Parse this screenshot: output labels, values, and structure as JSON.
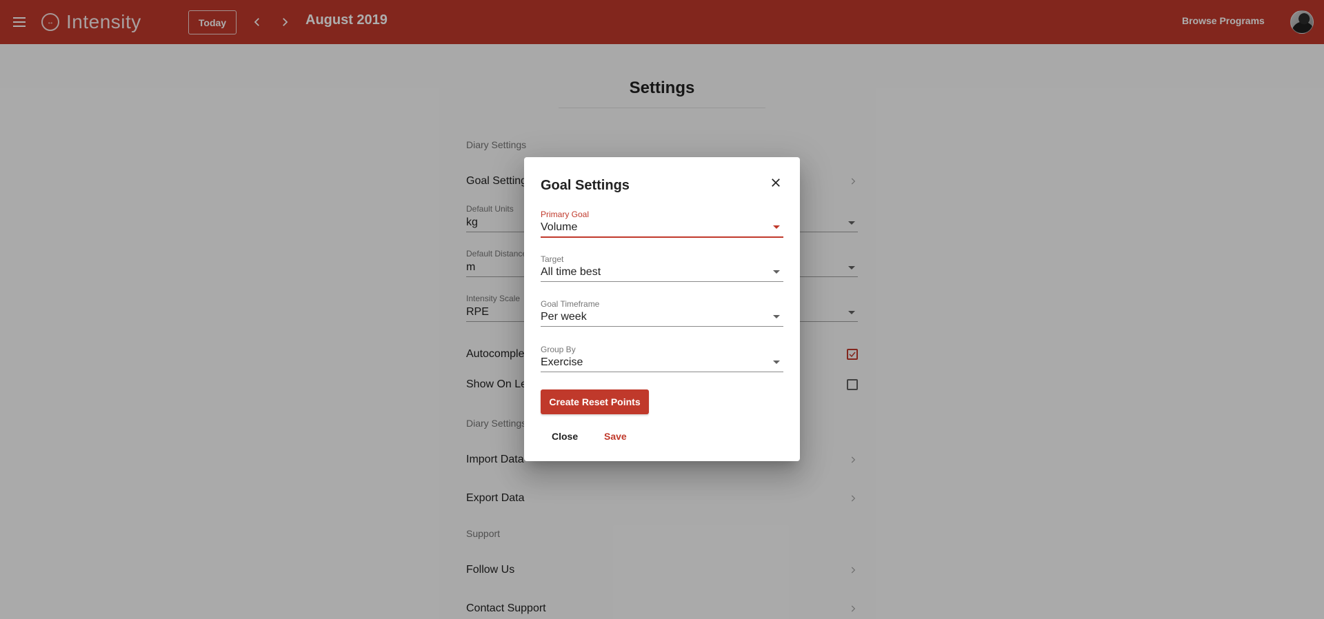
{
  "topbar": {
    "brand": "Intensity",
    "today_label": "Today",
    "month_label": "August 2019",
    "browse_label": "Browse Programs",
    "color": "#c0392b"
  },
  "page": {
    "title": "Settings",
    "section_diary": "Diary Settings",
    "goal_settings_label": "Goal Settings",
    "default_units": {
      "label": "Default Units",
      "value": "kg"
    },
    "default_distance": {
      "label": "Default Distance Units",
      "value": "m"
    },
    "intensity_scale": {
      "label": "Intensity Scale",
      "value": "RPE"
    },
    "autocomplete_label": "Autocomplete",
    "show_on_label": "Show On Left",
    "section_diary2": "Diary Settings",
    "import_label": "Import Data",
    "export_label": "Export Data",
    "section_support": "Support",
    "follow_label": "Follow Us",
    "contact_label": "Contact Support"
  },
  "dialog": {
    "title": "Goal Settings",
    "primary_goal": {
      "label": "Primary Goal",
      "value": "Volume"
    },
    "target": {
      "label": "Target",
      "value": "All time best"
    },
    "timeframe": {
      "label": "Goal Timeframe",
      "value": "Per week"
    },
    "group_by": {
      "label": "Group By",
      "value": "Exercise"
    },
    "reset_label": "Create Reset Points",
    "close_label": "Close",
    "save_label": "Save"
  }
}
